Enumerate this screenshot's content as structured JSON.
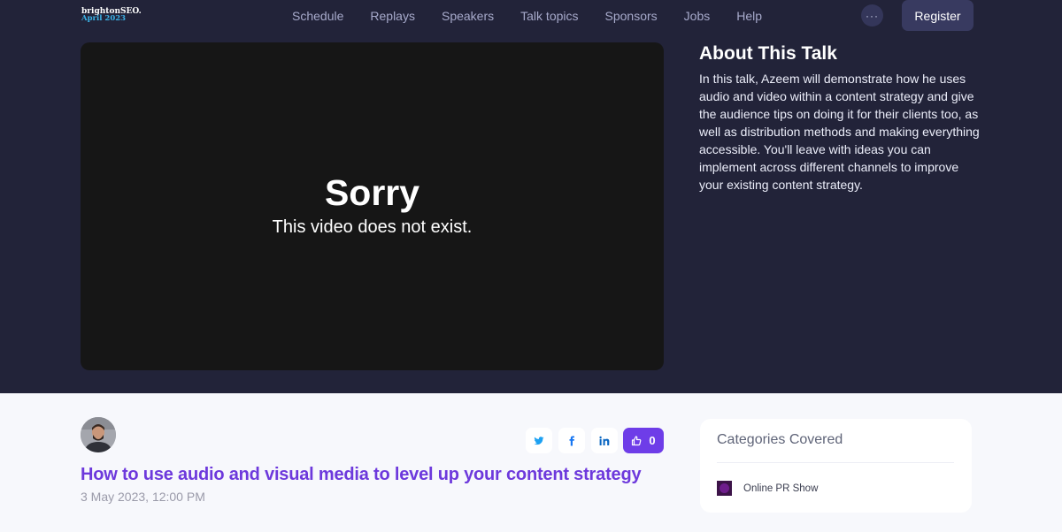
{
  "brand": {
    "name": "brightonSEO.",
    "edition": "April 2023"
  },
  "nav": {
    "links": [
      "Schedule",
      "Replays",
      "Speakers",
      "Talk topics",
      "Sponsors",
      "Jobs",
      "Help"
    ],
    "more_label": "···",
    "register_label": "Register"
  },
  "video": {
    "error_title": "Sorry",
    "error_message": "This video does not exist."
  },
  "about": {
    "heading": "About This Talk",
    "description": "In this talk, Azeem will demonstrate how he uses audio and video within a content strategy and give the audience tips on doing it for their clients too, as well as distribution methods and making everything accessible. You'll leave with ideas you can implement across different channels to improve your existing content strategy."
  },
  "talk": {
    "title": "How to use audio and visual media to level up your content strategy",
    "datetime": "3 May 2023, 12:00 PM",
    "likes": "0"
  },
  "share": {
    "icons": [
      "twitter-icon",
      "facebook-icon",
      "linkedin-icon",
      "thumbs-up-icon"
    ]
  },
  "categories": {
    "heading": "Categories Covered",
    "items": [
      {
        "label": "Online PR Show"
      }
    ]
  },
  "colors": {
    "header_bg": "#222339",
    "page_bg": "#f7f8fc",
    "accent_purple": "#6e3de8",
    "title_purple": "#6d39dc",
    "twitter_blue": "#1da1f2",
    "facebook_blue": "#1877f2",
    "linkedin_blue": "#0a66c2"
  }
}
